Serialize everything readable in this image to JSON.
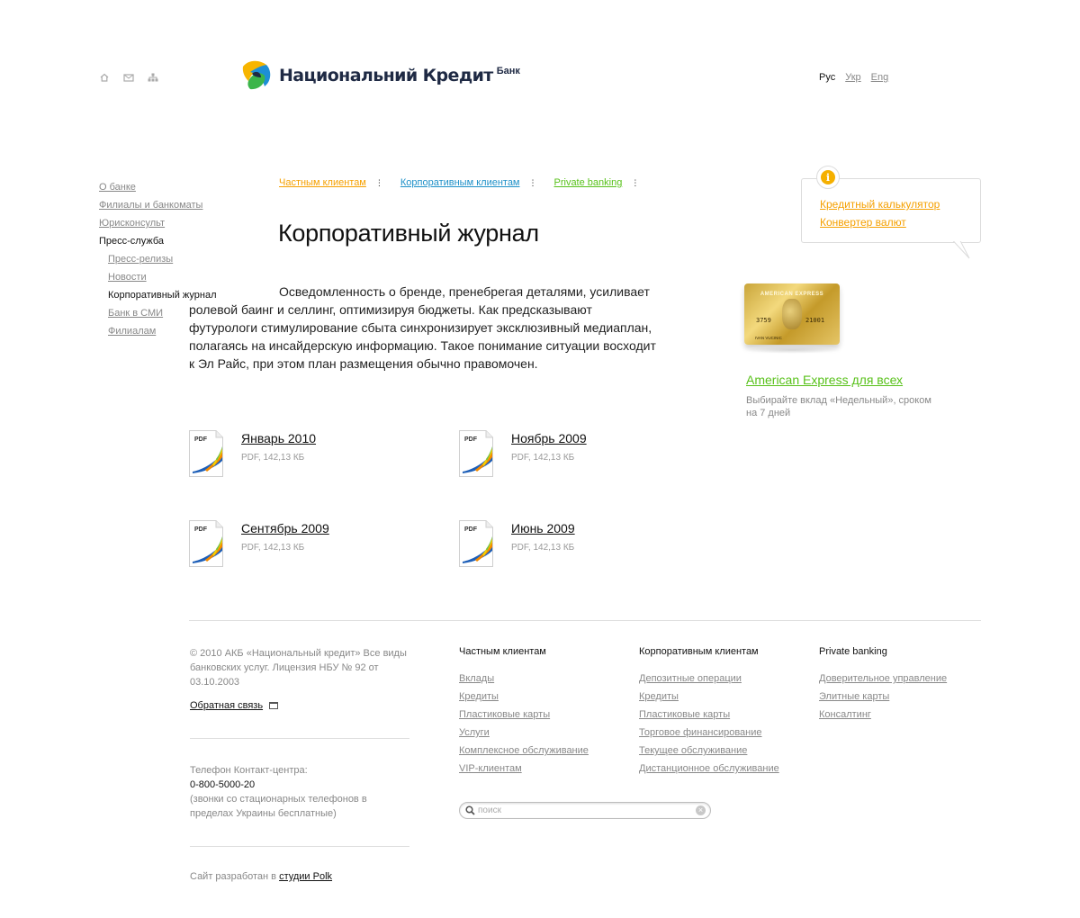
{
  "header": {
    "icons": [
      "home-icon",
      "mail-icon",
      "sitemap-icon"
    ],
    "logo_text": "Национальний Кредит",
    "logo_sub": "Банк",
    "languages": {
      "active": "Рус",
      "others": [
        "Укр",
        "Eng"
      ]
    }
  },
  "left_nav": {
    "items": [
      {
        "label": "О банке"
      },
      {
        "label": "Филиалы и банкоматы"
      },
      {
        "label": "Юрисконсульт"
      },
      {
        "label": "Пресс-служба"
      }
    ],
    "sub_items": [
      {
        "label": "Пресс-релизы"
      },
      {
        "label": "Новости"
      },
      {
        "label": "Корпоративный журнал"
      },
      {
        "label": "Банк в СМИ"
      },
      {
        "label": "Филиалам"
      }
    ]
  },
  "category_nav": [
    {
      "label": "Частным клиентам",
      "color": "#f5a000"
    },
    {
      "label": "Корпоративным клиентам",
      "color": "#1e90c8"
    },
    {
      "label": "Private banking",
      "color": "#58c11a"
    }
  ],
  "main": {
    "title": "Корпоративный журнал",
    "intro": "Осведомленность о бренде, пренебрегая деталями, усиливает ролевой баинг и селлинг, оптимизируя бюджеты. Как предсказывают футурологи стимулирование сбыта синхронизирует эксклюзивный медиаплан, полагаясь на инсайдерскую информацию. Такое понимание ситуации восходит к Эл Райс, при этом план размещения обычно правомочен.",
    "files": [
      {
        "name": "Январь 2010",
        "meta": "PDF, 142,13 КБ"
      },
      {
        "name": "Ноябрь 2009",
        "meta": "PDF, 142,13 КБ"
      },
      {
        "name": "Сентябрь 2009",
        "meta": "PDF, 142,13 КБ"
      },
      {
        "name": "Июнь 2009",
        "meta": "PDF, 142,13 КБ"
      }
    ],
    "pdf_badge": "PDF"
  },
  "sidebar": {
    "info_links": [
      "Кредитный калькулятор",
      "Конвертер валют"
    ],
    "card": {
      "brand": "AMERICAN EXPRESS",
      "num_left": "3759",
      "num_right": "21001",
      "holder": "IVAN VUCINIC"
    },
    "promo_title": "American Express для всех",
    "promo_text": "Выбирайте вклад «Недельный», сроком на 7 дней"
  },
  "footer": {
    "copyright": "© 2010 АКБ «Национальный кредит» Все виды банковских услуг. Лицензия НБУ № 92 от 03.10.2003",
    "feedback": "Обратная связь",
    "phone_label": "Телефон Контакт-центра:",
    "phone_number": "0-800-5000-20",
    "phone_note": "(звонки со стационарных телефонов в пределах Украины бесплатные)",
    "dev_prefix": "Сайт разработан в",
    "dev_link": "студии Polk",
    "columns": [
      {
        "head": "Частным клиентам",
        "links": [
          "Вклады",
          "Кредиты",
          "Пластиковые карты",
          "Услуги",
          "Комплексное обслуживание",
          "VIP-клиентам"
        ]
      },
      {
        "head": "Корпоративным клиентам",
        "links": [
          "Депозитные операции",
          "Кредиты",
          "Пластиковые карты",
          "Торговое финансирование",
          "Текущее обслуживание",
          "Дистанционное обслуживание"
        ]
      },
      {
        "head": "Private banking",
        "links": [
          "Доверительное управление",
          "Элитные карты",
          "Консалтинг"
        ]
      }
    ],
    "search_placeholder": "поиск"
  }
}
